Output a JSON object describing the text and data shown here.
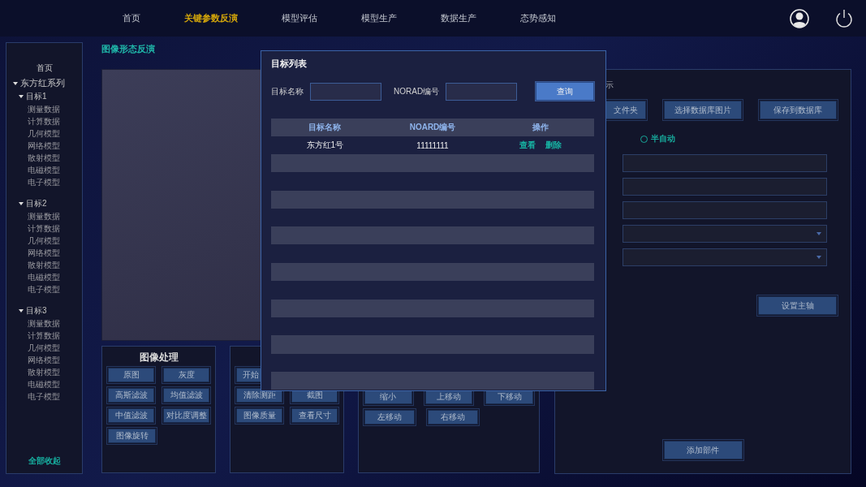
{
  "nav": {
    "items": [
      {
        "label": "首页",
        "selected": false
      },
      {
        "label": "关键参数反演",
        "selected": true
      },
      {
        "label": "模型评估",
        "selected": false
      },
      {
        "label": "模型生产",
        "selected": false
      },
      {
        "label": "数据生产",
        "selected": false
      },
      {
        "label": "态势感知",
        "selected": false
      }
    ]
  },
  "sidebar": {
    "home": "首页",
    "tree": [
      {
        "label": "东方红系列",
        "expanded": true,
        "children": [
          {
            "label": "目标1",
            "expanded": true,
            "children": [
              {
                "label": "测量数据"
              },
              {
                "label": "计算数据"
              },
              {
                "label": "几何模型"
              },
              {
                "label": "网络模型"
              },
              {
                "label": "散射模型"
              },
              {
                "label": "电磁模型"
              },
              {
                "label": "电子模型"
              }
            ]
          },
          {
            "label": "目标2",
            "expanded": true,
            "children": [
              {
                "label": "测量数据"
              },
              {
                "label": "计算数据"
              },
              {
                "label": "几何模型"
              },
              {
                "label": "网络模型"
              },
              {
                "label": "散射模型"
              },
              {
                "label": "电磁模型"
              },
              {
                "label": "电子模型"
              }
            ]
          },
          {
            "label": "目标3",
            "expanded": true,
            "children": [
              {
                "label": "测量数据"
              },
              {
                "label": "计算数据"
              },
              {
                "label": "几何模型"
              },
              {
                "label": "网络模型"
              },
              {
                "label": "散射模型"
              },
              {
                "label": "电磁模型"
              },
              {
                "label": "电子模型"
              }
            ]
          }
        ]
      }
    ],
    "collapse_all": "全部收起"
  },
  "page_title": "图像形态反演",
  "tool_panels": [
    {
      "title": "图像处理",
      "rows": [
        [
          "原图",
          "灰度"
        ],
        [
          "高斯滤波",
          "均值滤波"
        ],
        [
          "中值滤波",
          "对比度调整"
        ],
        [
          "图像旋转"
        ]
      ]
    },
    {
      "rows": [
        [
          "开始"
        ],
        [
          "清除测距",
          "截图"
        ],
        [
          "图像质量",
          "查看尺寸"
        ]
      ]
    },
    {
      "rows": [
        [
          "缩小",
          "上移动",
          "下移动"
        ],
        [
          "左移动",
          "右移动"
        ]
      ]
    }
  ],
  "right_panel": {
    "title": "示",
    "buttons": [
      "文件夹",
      "选择数据库图片",
      "保存到数据库"
    ],
    "radio": {
      "label": "半自动",
      "selected": false
    },
    "fields": [
      {
        "kind": "text"
      },
      {
        "kind": "text"
      },
      {
        "kind": "text"
      },
      {
        "kind": "select"
      },
      {
        "kind": "select"
      }
    ],
    "axis_button": "设置主轴",
    "add_button": "添加部件"
  },
  "modal": {
    "title": "目标列表",
    "search": [
      {
        "label": "目标名称"
      },
      {
        "label": "NORAD编号"
      }
    ],
    "query_button": "查询",
    "table": {
      "columns": [
        "目标名称",
        "NOARD编号",
        "操作"
      ],
      "rows": [
        {
          "name": "东方红1号",
          "norad": "11111111",
          "actions": [
            "查看",
            "删除"
          ]
        }
      ]
    }
  }
}
